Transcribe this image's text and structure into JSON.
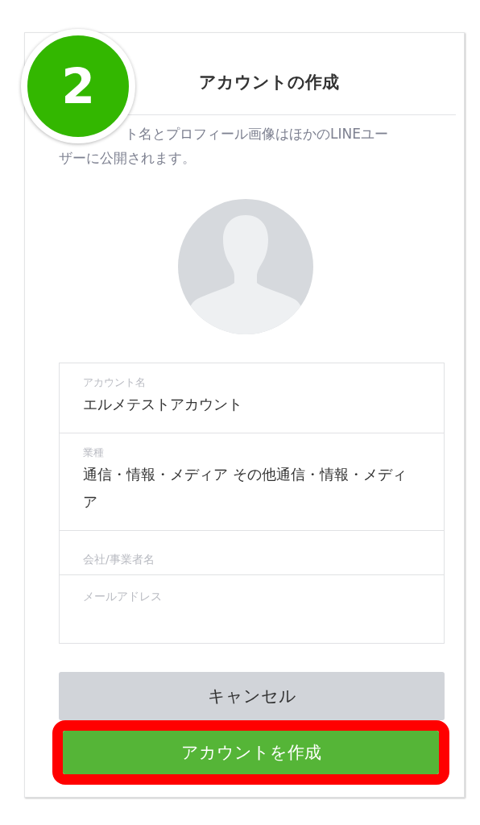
{
  "step_badge": "2",
  "title": "アカウントの作成",
  "notice_lines": [
    "ト名とプロフィール画像はほかのLINEユー",
    "ザーに公開されます。"
  ],
  "avatar": {
    "kind": "placeholder"
  },
  "fields": [
    {
      "kind": "filled",
      "label": "アカウント名",
      "value": "エルメテストアカウント"
    },
    {
      "kind": "filled",
      "label": "業種",
      "value": "通信・情報・メディア その他通信・情報・メディア"
    },
    {
      "kind": "empty",
      "placeholder": "会社/事業者名"
    },
    {
      "kind": "multiline",
      "placeholder": "メールアドレス"
    }
  ],
  "buttons": [
    {
      "kind": "cancel",
      "label": "キャンセル",
      "highlighted": false
    },
    {
      "kind": "primary",
      "label": "アカウントを作成",
      "highlighted": true
    }
  ]
}
